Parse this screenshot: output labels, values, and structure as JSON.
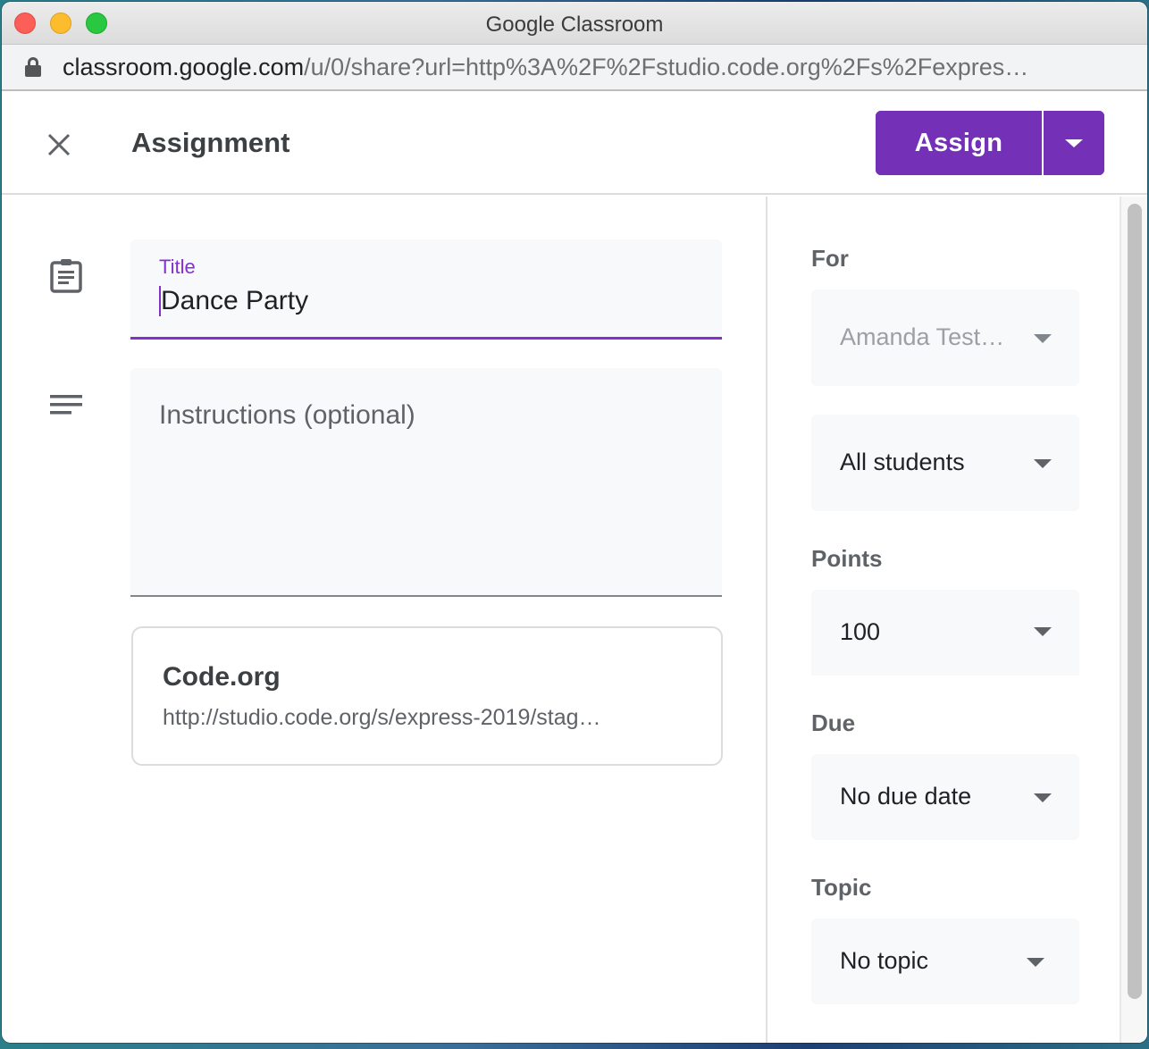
{
  "window": {
    "title": "Google Classroom"
  },
  "address_bar": {
    "host": "classroom.google.com",
    "path": "/u/0/share?url=http%3A%2F%2Fstudio.code.org%2Fs%2Fexpres…"
  },
  "header": {
    "title": "Assignment",
    "assign_label": "Assign"
  },
  "form": {
    "title_label": "Title",
    "title_value": "Dance Party",
    "instructions_placeholder": "Instructions (optional)",
    "attachment": {
      "title": "Code.org",
      "url": "http://studio.code.org/s/express-2019/stag…"
    }
  },
  "sidebar": {
    "for_label": "For",
    "class_value": "Amanda Test…",
    "students_value": "All students",
    "points_label": "Points",
    "points_value": "100",
    "due_label": "Due",
    "due_value": "No due date",
    "topic_label": "Topic",
    "topic_value": "No topic"
  },
  "colors": {
    "accent": "#7431b8",
    "title_focus": "#8430ce"
  }
}
